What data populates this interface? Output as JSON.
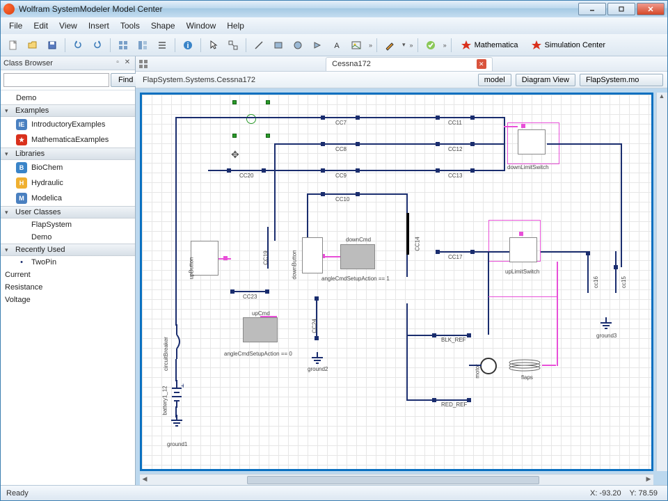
{
  "titlebar": {
    "title": "Wolfram SystemModeler Model Center"
  },
  "menu": [
    "File",
    "Edit",
    "View",
    "Insert",
    "Tools",
    "Shape",
    "Window",
    "Help"
  ],
  "toolbar": {
    "mathematica": "Mathematica",
    "simcenter": "Simulation Center"
  },
  "classBrowser": {
    "title": "Class Browser",
    "find": "Find",
    "demo": "Demo",
    "sections": {
      "examples": "Examples",
      "libraries": "Libraries",
      "userClasses": "User Classes",
      "recent": "Recently Used"
    },
    "examples": [
      "IntroductoryExamples",
      "MathematicaExamples"
    ],
    "libraries": [
      "BioChem",
      "Hydraulic",
      "Modelica"
    ],
    "userClasses": [
      "FlapSystem",
      "Demo"
    ],
    "recent": [
      "TwoPin"
    ],
    "extras": [
      "Current",
      "Resistance",
      "Voltage"
    ]
  },
  "tabs": {
    "active": "Cessna172"
  },
  "pathbar": {
    "path": "FlapSystem.Systems.Cessna172",
    "model": "model",
    "view": "Diagram View",
    "file": "FlapSystem.mo"
  },
  "diagram": {
    "labels": {
      "cc7": "CC7",
      "cc8": "CC8",
      "cc9": "CC9",
      "cc10": "CC10",
      "cc11": "CC11",
      "cc12": "CC12",
      "cc13": "CC13",
      "cc17": "CC17",
      "cc20": "CC20",
      "cc23": "CC23",
      "downLimitSwitch": "downLimitSwitch",
      "upLimitSwitch": "upLimitSwitch",
      "downCmd": "downCmd",
      "upCmd": "upCmd",
      "ground1": "ground1",
      "ground2": "ground2",
      "ground3": "ground3",
      "blkRef": "BLK_REF",
      "redRef": "RED_REF",
      "flaps": "flaps",
      "motor": "motor",
      "angleSetup1": "angleCmdSetupAction == 1",
      "angleSetup0": "angleCmdSetupAction == 0",
      "circuitBreaker": "circuitBreaker",
      "battery": "battery1_12",
      "upButton": "upButton",
      "downButton": "downButton",
      "cc14": "CC14",
      "cc19": "CC19",
      "cc16": "cc16",
      "cc15": "cc15",
      "cc24": "CC24"
    }
  },
  "status": {
    "ready": "Ready",
    "x": "X: -93.20",
    "y": "Y: 78.59"
  }
}
